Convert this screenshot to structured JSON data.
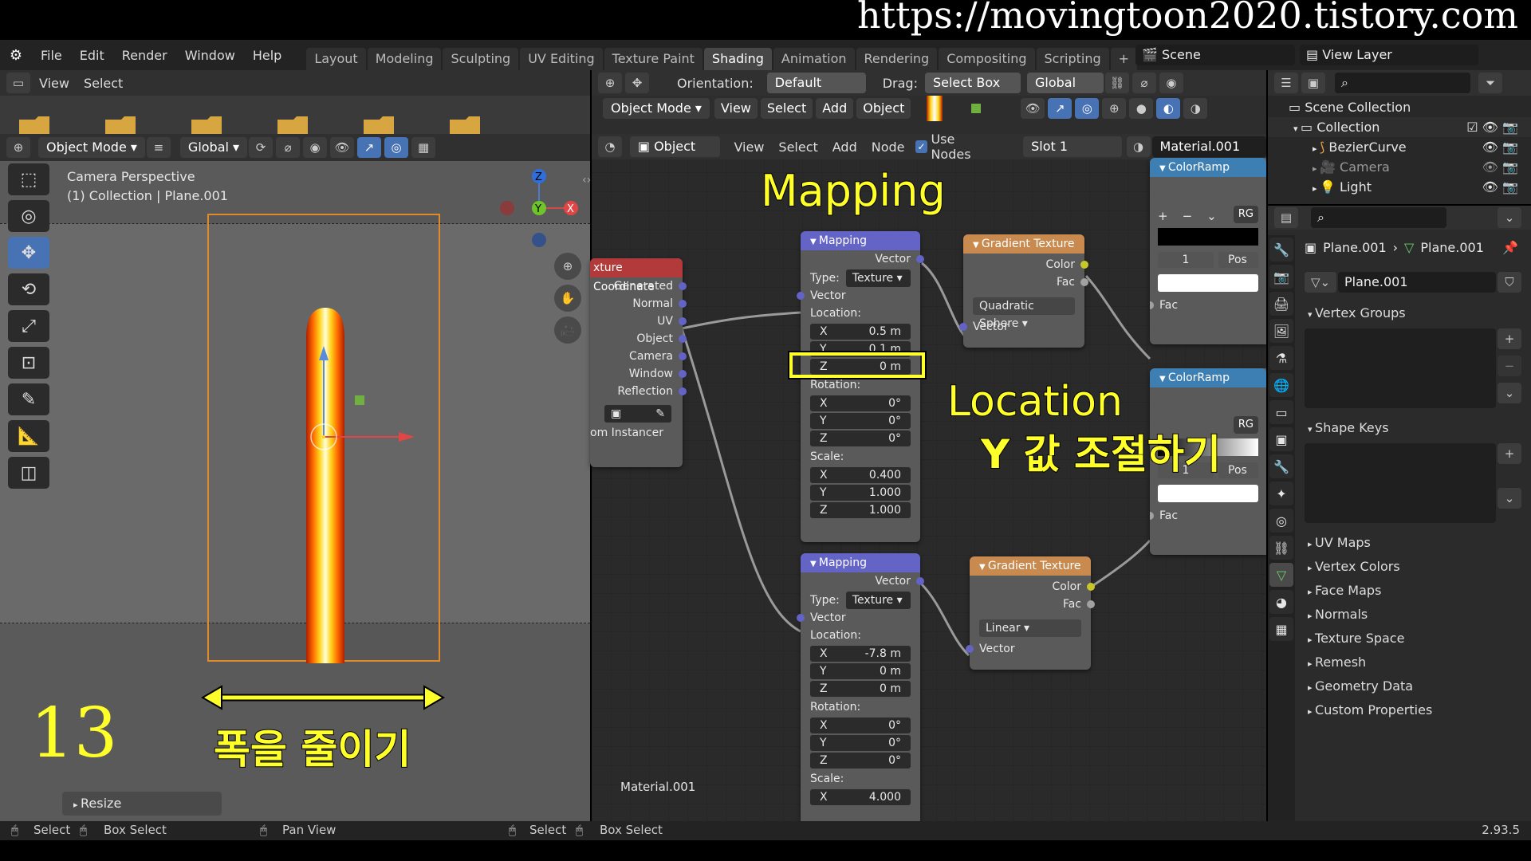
{
  "watermark": {
    "url": "https://movingtoon2020.tistory.com"
  },
  "menu": [
    "File",
    "Edit",
    "Render",
    "Window",
    "Help"
  ],
  "workspaces": [
    "Layout",
    "Modeling",
    "Sculpting",
    "UV Editing",
    "Texture Paint",
    "Shading",
    "Animation",
    "Rendering",
    "Compositing",
    "Scripting",
    "+"
  ],
  "active_workspace": "Shading",
  "scene": {
    "label": "Scene",
    "view_layer": "View Layer"
  },
  "filebrowser": {
    "view": "View",
    "select": "Select"
  },
  "viewport": {
    "mode": "Object Mode",
    "orientation": "Global",
    "overlay_title": "Camera Perspective",
    "overlay_sub": "(1) Collection | Plane.001",
    "gizmo": {
      "z": "Z",
      "y": "Y",
      "x": "X"
    },
    "resize_panel": "Resize"
  },
  "image_editor": {
    "orientation_label": "Orientation:",
    "orientation_value": "Default",
    "drag_label": "Drag:",
    "drag_value": "Select Box",
    "transform": "Global",
    "mode": "Object Mode",
    "menu": [
      "View",
      "Select",
      "Add",
      "Object"
    ]
  },
  "node_editor": {
    "object": "Object",
    "menu": [
      "View",
      "Select",
      "Add",
      "Node"
    ],
    "use_nodes": "Use Nodes",
    "slot": "Slot 1",
    "material": "Material.001",
    "footer_material": "Material.001"
  },
  "nodes": {
    "texcoord": {
      "title": "xture Coordinate",
      "outputs": [
        "Generated",
        "Normal",
        "UV",
        "Object",
        "Camera",
        "Window",
        "Reflection"
      ],
      "instancer": "om Instancer"
    },
    "mapping1": {
      "title": "Mapping",
      "out": "Vector",
      "type_label": "Type:",
      "type": "Texture",
      "in": "Vector",
      "location": "Location:",
      "loc": [
        {
          "axis": "X",
          "val": "0.5 m"
        },
        {
          "axis": "Y",
          "val": "0.1 m"
        },
        {
          "axis": "Z",
          "val": "0 m"
        }
      ],
      "rotation": "Rotation:",
      "rot": [
        {
          "axis": "X",
          "val": "0°"
        },
        {
          "axis": "Y",
          "val": "0°"
        },
        {
          "axis": "Z",
          "val": "0°"
        }
      ],
      "scale": "Scale:",
      "scl": [
        {
          "axis": "X",
          "val": "0.400"
        },
        {
          "axis": "Y",
          "val": "1.000"
        },
        {
          "axis": "Z",
          "val": "1.000"
        }
      ]
    },
    "mapping2": {
      "title": "Mapping",
      "out": "Vector",
      "type_label": "Type:",
      "type": "Texture",
      "in": "Vector",
      "location": "Location:",
      "loc": [
        {
          "axis": "X",
          "val": "-7.8 m"
        },
        {
          "axis": "Y",
          "val": "0 m"
        },
        {
          "axis": "Z",
          "val": "0 m"
        }
      ],
      "rotation": "Rotation:",
      "rot": [
        {
          "axis": "X",
          "val": "0°"
        },
        {
          "axis": "Y",
          "val": "0°"
        },
        {
          "axis": "Z",
          "val": "0°"
        }
      ],
      "scale": "Scale:",
      "scl": [
        {
          "axis": "X",
          "val": "4.000"
        }
      ]
    },
    "grad1": {
      "title": "Gradient Texture",
      "color": "Color",
      "fac": "Fac",
      "type": "Quadratic Sphere",
      "vector": "Vector"
    },
    "grad2": {
      "title": "Gradient Texture",
      "color": "Color",
      "fac": "Fac",
      "type": "Linear",
      "vector": "Vector"
    },
    "ramp1": {
      "title": "ColorRamp",
      "mode": "RG",
      "index": "1",
      "pos": "Pos",
      "fac": "Fac"
    },
    "ramp2": {
      "title": "ColorRamp",
      "mode": "RG",
      "index": "1",
      "pos": "Pos",
      "fac": "Fac"
    }
  },
  "outliner": {
    "title": "Scene Collection",
    "items": [
      "Collection",
      "BezierCurve",
      "Camera",
      "Light"
    ]
  },
  "properties": {
    "object": "Plane.001",
    "data": "Plane.001",
    "mesh": "Plane.001",
    "sections_open": [
      "Vertex Groups",
      "Shape Keys"
    ],
    "sections": [
      "UV Maps",
      "Vertex Colors",
      "Face Maps",
      "Normals",
      "Texture Space",
      "Remesh",
      "Geometry Data",
      "Custom Properties"
    ]
  },
  "status": {
    "select": "Select",
    "box_select": "Box Select",
    "pan": "Pan View",
    "select2": "Select",
    "box_select2": "Box Select",
    "version": "2.93.5"
  },
  "annotations": {
    "mapping": "Mapping",
    "location": "Location",
    "location_y": "Y 값 조절하기",
    "step": "13",
    "width": "폭을 줄이기"
  },
  "colors": {
    "accent": "#4772b3",
    "highlight": "#ffff2a",
    "fire_core": "#ffffff",
    "fire_mid": "#ffd21a",
    "fire_edge": "#e03a00"
  }
}
